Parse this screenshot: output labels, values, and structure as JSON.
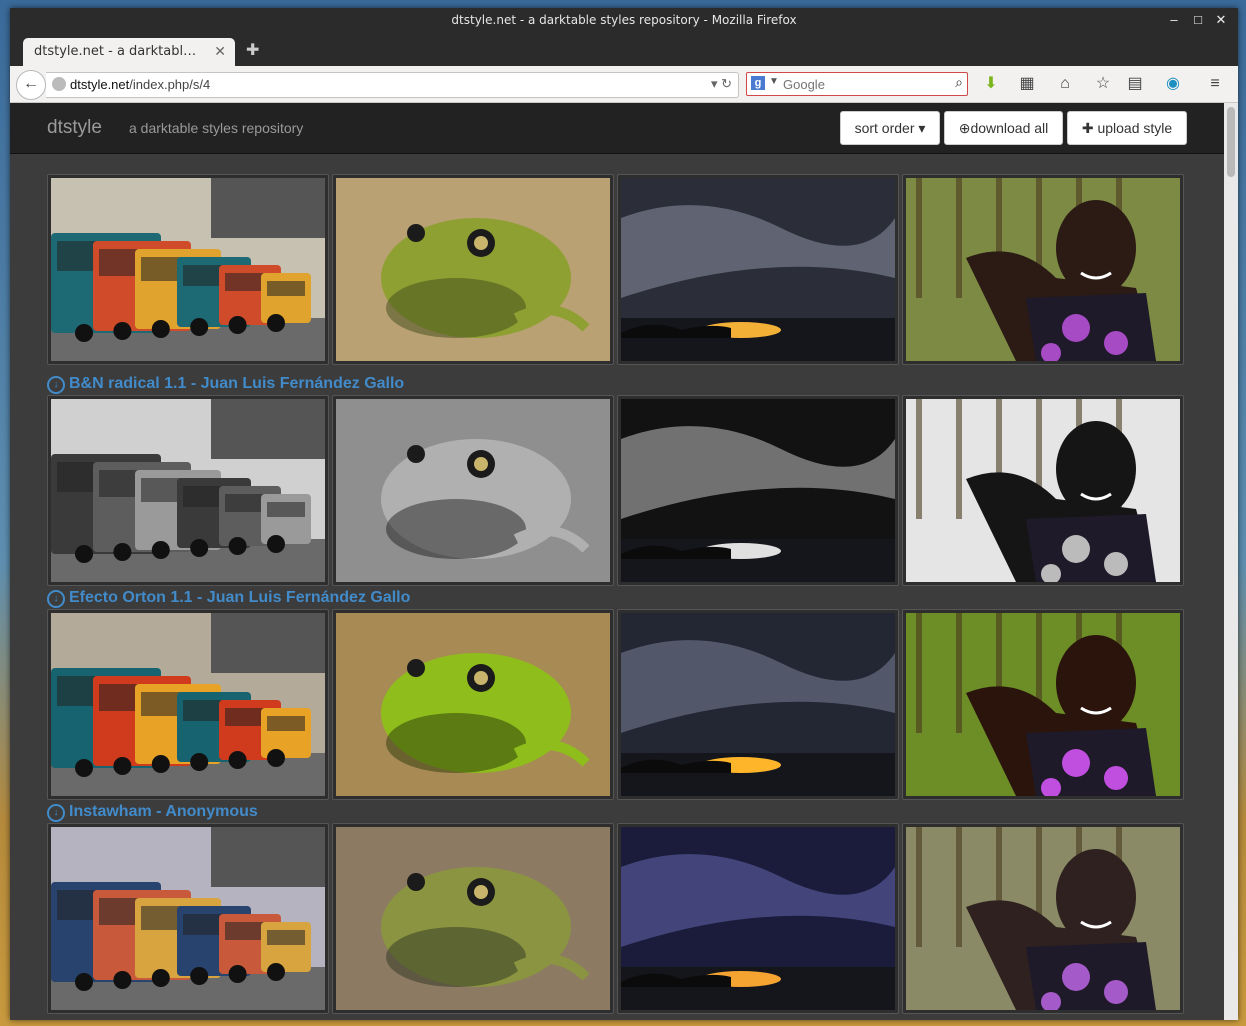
{
  "window": {
    "title": "dtstyle.net - a darktable styles repository - Mozilla Firefox"
  },
  "tab": {
    "label": "dtstyle.net - a darktable styles repository"
  },
  "urlbar": {
    "host": "dtstyle.net",
    "path": "/index.php/s/4"
  },
  "search": {
    "placeholder": "Google"
  },
  "site": {
    "brand": "dtstyle",
    "tagline": "a darktable styles repository",
    "buttons": {
      "sort": "sort order ▾",
      "download": "download all",
      "upload": "upload style"
    }
  },
  "styles": [
    {
      "title": ""
    },
    {
      "title": "B&N radical 1.1 - Juan Luis Fernández Gallo"
    },
    {
      "title": "Efecto Orton 1.1 - Juan Luis Fernández Gallo"
    },
    {
      "title": "Instawham - Anonymous"
    }
  ],
  "photos": [
    "trucks",
    "frog",
    "sunset",
    "girl"
  ],
  "palettes": [
    {
      "name": "color",
      "trucks": [
        "#c7c1b2",
        "#1e6a74",
        "#d04b2a",
        "#e0a32e"
      ],
      "frog": [
        "#b9a173",
        "#8fa032",
        "#3f4a19"
      ],
      "sunset": [
        "#6d7081",
        "#2b2d38",
        "#f2b037"
      ],
      "girl": [
        "#7d8a44",
        "#2b1b14",
        "#a64bc4"
      ]
    },
    {
      "name": "bw",
      "trucks": [
        "#d0d0d0",
        "#3a3a3a",
        "#5d5d5d",
        "#9a9a9a"
      ],
      "frog": [
        "#8f8f8f",
        "#b0b0b0",
        "#222222"
      ],
      "sunset": [
        "#8a8a8a",
        "#121212",
        "#e0e0e0"
      ],
      "girl": [
        "#e5e5e5",
        "#151515",
        "#bbbbbb"
      ]
    },
    {
      "name": "orton",
      "trucks": [
        "#b3aa9a",
        "#176470",
        "#cf3b1c",
        "#e8a327"
      ],
      "frog": [
        "#a88a55",
        "#8fbe1c",
        "#2a3a09"
      ],
      "sunset": [
        "#5e6478",
        "#232733",
        "#ffb52a"
      ],
      "girl": [
        "#6d8d27",
        "#2a140c",
        "#c04fe0"
      ]
    },
    {
      "name": "instawham",
      "trucks": [
        "#b6b3c0",
        "#27436e",
        "#c8593a",
        "#d8a440"
      ],
      "frog": [
        "#8c7b62",
        "#8b9440",
        "#303624"
      ],
      "sunset": [
        "#4d508a",
        "#1b1c3c",
        "#f5a331"
      ],
      "girl": [
        "#8a8a66",
        "#2f211f",
        "#a45bc9"
      ]
    }
  ]
}
